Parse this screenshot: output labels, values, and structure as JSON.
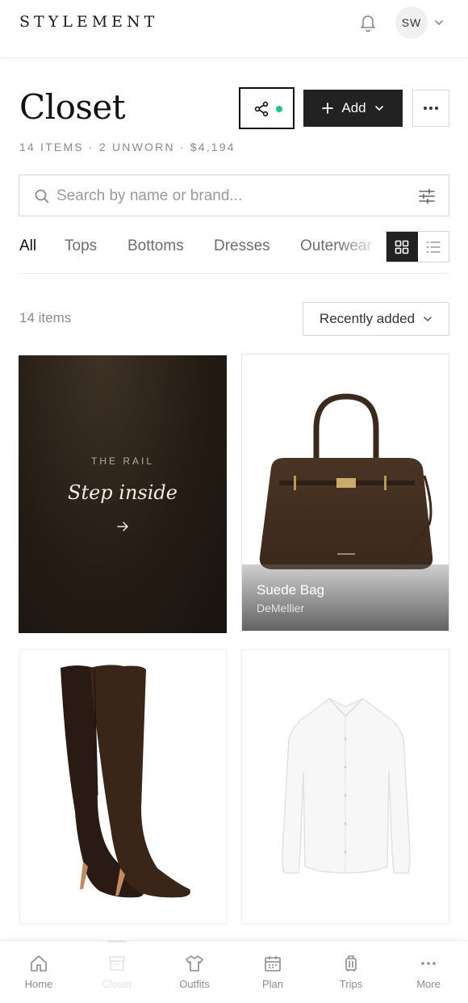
{
  "header": {
    "logo": "STYLEMENT",
    "avatar_initials": "SW"
  },
  "page": {
    "title": "Closet",
    "stats": "14 ITEMS · 2 UNWORN · $4,194",
    "add_label": "Add"
  },
  "search": {
    "placeholder": "Search by name or brand..."
  },
  "tabs": [
    "All",
    "Tops",
    "Bottoms",
    "Dresses",
    "Outerwear"
  ],
  "view_mode": "grid",
  "list": {
    "count": "14 items",
    "sort": "Recently added"
  },
  "promo": {
    "eyebrow": "THE RAIL",
    "title": "Step inside"
  },
  "items": [
    {
      "name": "Suede Bag",
      "brand": "DeMellier"
    }
  ],
  "bottom_nav": [
    {
      "label": "Home",
      "icon": "home-icon"
    },
    {
      "label": "Closet",
      "icon": "closet-icon"
    },
    {
      "label": "Outfits",
      "icon": "shirt-icon"
    },
    {
      "label": "Plan",
      "icon": "calendar-icon"
    },
    {
      "label": "Trips",
      "icon": "suitcase-icon"
    },
    {
      "label": "More",
      "icon": "more-icon"
    }
  ],
  "colors": {
    "accent_dark": "#222222",
    "status_dot": "#1ec48b",
    "promo_bg": "#251c14"
  }
}
